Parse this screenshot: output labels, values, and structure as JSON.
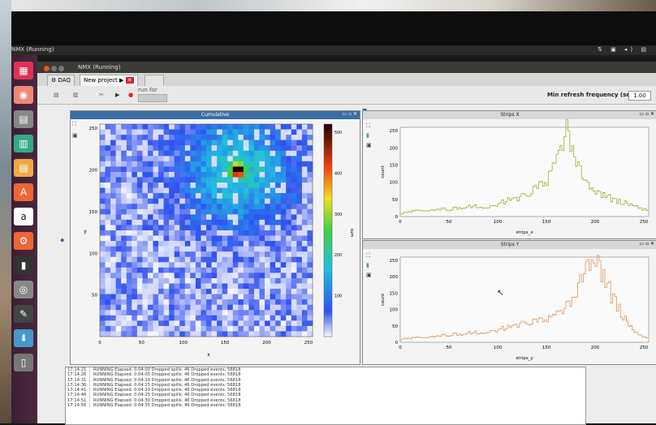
{
  "desktop": {
    "top_title": "NMX (Running)",
    "tray": "⇅ ▣ ◂) ▤",
    "launcher_icons": [
      "files-icon",
      "firefox-icon",
      "files-icon",
      "spreadsheet-icon",
      "notes-icon",
      "software-center-icon",
      "amazon-icon",
      "settings-icon",
      "terminal-icon",
      "dvd-icon",
      "pen-icon",
      "download-icon",
      "trash-icon"
    ]
  },
  "window": {
    "title": "NMX (Running)",
    "tabs": [
      {
        "label": "DAQ"
      },
      {
        "label": "New project ▶"
      }
    ],
    "toolbar": {
      "run_for_label": "run for",
      "refresh_label": "Min refresh frequency (secs)",
      "refresh_value": "1.00"
    }
  },
  "cumulative": {
    "title": "Cumulative",
    "ylabel": "y",
    "xlabel": "x",
    "xticks": [
      "0",
      "50",
      "100",
      "150",
      "200",
      "250"
    ],
    "yticks": [
      "250",
      "200",
      "150",
      "100",
      "50"
    ],
    "colorbar_label": "sum",
    "colorbar_ticks": [
      "500",
      "400",
      "300",
      "200",
      "100"
    ],
    "hotspot": {
      "x": 165,
      "y": 199,
      "value": 500
    }
  },
  "strips_x": {
    "title": "Strips X",
    "xlabel": "strips_x",
    "ylabel": "count",
    "color": "#a8b84a",
    "xticks": [
      "0",
      "50",
      "100",
      "150",
      "200",
      "250"
    ],
    "yticks": [
      "0",
      "50",
      "100",
      "150",
      "200",
      "250"
    ],
    "chart_data": {
      "type": "line",
      "x_range": [
        0,
        255
      ],
      "y_range": [
        0,
        260
      ],
      "x": [
        0,
        10,
        20,
        30,
        40,
        50,
        60,
        70,
        80,
        90,
        100,
        110,
        120,
        130,
        140,
        150,
        155,
        160,
        165,
        170,
        175,
        180,
        185,
        190,
        195,
        200,
        210,
        220,
        230,
        240,
        250
      ],
      "y": [
        8,
        15,
        18,
        20,
        22,
        20,
        26,
        28,
        30,
        30,
        38,
        48,
        55,
        65,
        80,
        110,
        150,
        170,
        220,
        250,
        210,
        160,
        120,
        90,
        80,
        70,
        60,
        45,
        40,
        30,
        20
      ]
    }
  },
  "strips_y": {
    "title": "Strips Y",
    "xlabel": "strips_y",
    "ylabel": "count",
    "color": "#e0a070",
    "xticks": [
      "0",
      "50",
      "100",
      "150",
      "200",
      "250"
    ],
    "yticks": [
      "0",
      "50",
      "100",
      "150",
      "200",
      "250"
    ],
    "chart_data": {
      "type": "line",
      "x_range": [
        0,
        255
      ],
      "y_range": [
        0,
        260
      ],
      "x": [
        0,
        10,
        20,
        30,
        40,
        50,
        60,
        70,
        80,
        90,
        100,
        110,
        120,
        130,
        140,
        150,
        160,
        170,
        180,
        185,
        190,
        195,
        200,
        205,
        210,
        220,
        230,
        240,
        250
      ],
      "y": [
        10,
        12,
        15,
        18,
        20,
        22,
        25,
        28,
        30,
        35,
        40,
        45,
        55,
        60,
        60,
        75,
        90,
        110,
        150,
        185,
        210,
        230,
        250,
        220,
        180,
        120,
        70,
        30,
        15
      ]
    }
  },
  "log": [
    {
      "time": "17:14:21",
      "msg": "RUNNING Elapsed: 0:04:00  Dropped spills: 46  Dropped events: 56818"
    },
    {
      "time": "17:14:26",
      "msg": "RUNNING Elapsed: 0:04:05  Dropped spills: 46  Dropped events: 56818"
    },
    {
      "time": "17:14:31",
      "msg": "RUNNING Elapsed: 0:04:10  Dropped spills: 46  Dropped events: 56818"
    },
    {
      "time": "17:14:36",
      "msg": "RUNNING Elapsed: 0:04:15  Dropped spills: 46  Dropped events: 56818"
    },
    {
      "time": "17:14:41",
      "msg": "RUNNING Elapsed: 0:04:20  Dropped spills: 46  Dropped events: 56818"
    },
    {
      "time": "17:14:46",
      "msg": "RUNNING Elapsed: 0:04:25  Dropped spills: 46  Dropped events: 56818"
    },
    {
      "time": "17:14:51",
      "msg": "RUNNING Elapsed: 0:04:30  Dropped spills: 46  Dropped events: 56818"
    },
    {
      "time": "17:14:56",
      "msg": "RUNNING Elapsed: 0:04:35  Dropped spills: 46  Dropped events: 56818"
    }
  ]
}
